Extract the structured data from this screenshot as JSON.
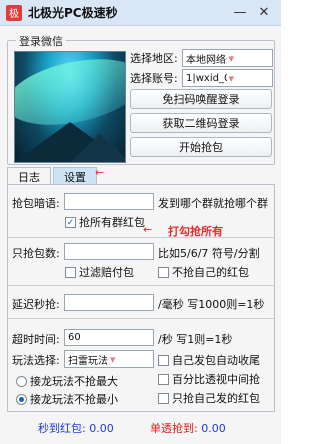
{
  "window": {
    "title": "北极光PC极速秒",
    "app_icon": "极",
    "minimize": "—",
    "close": "✕"
  },
  "login": {
    "group_title": "登录微信",
    "region_label": "选择地区:",
    "region_value": "本地网络登录",
    "account_label": "选择账号:",
    "account_value": "1|wxid_023eF",
    "btn_scanfree": "免扫码唤醒登录",
    "btn_qr": "获取二维码登录",
    "btn_start": "开始抢包"
  },
  "tabs": [
    {
      "label": "日志"
    },
    {
      "label": "设置"
    }
  ],
  "settings": {
    "password_label": "抢包暗语:",
    "password_value": "",
    "password_hint": "发到哪个群就抢哪个群",
    "grab_all_label": "抢所有群红包",
    "grab_all_checked": true,
    "annotation": "打勾抢所有",
    "count_label": "只抢包数:",
    "count_value": "",
    "count_hint": "比如5/6/7 符号/分割",
    "filter_label": "过滤赔付包",
    "own_label": "不抢自己的红包",
    "delay_label": "延迟秒抢:",
    "delay_value": "",
    "delay_hint": "/毫秒 写1000则=1秒",
    "timeout_label": "超时时间:",
    "timeout_value": "60",
    "timeout_hint": "/秒 写1则=1秒",
    "play_label": "玩法选择:",
    "play_value": "扫雷玩法",
    "radio1_label": "接龙玩法不抢最大",
    "radio2_label": "接龙玩法不抢最小",
    "auto_collect_label": "自己发包自动收尾",
    "percent_label": "百分比透视中间抢",
    "only_own_label": "只抢自己发的红包"
  },
  "status": {
    "grabbed_label": "秒到红包:",
    "grabbed_value": "0.00",
    "single_label": "单透抢到:",
    "single_value": "0.00"
  },
  "colors": {
    "accent": "#1a5ec4",
    "status_text": "#1f3fd1",
    "single_text": "#d62020",
    "annotation": "#e52b2b"
  }
}
